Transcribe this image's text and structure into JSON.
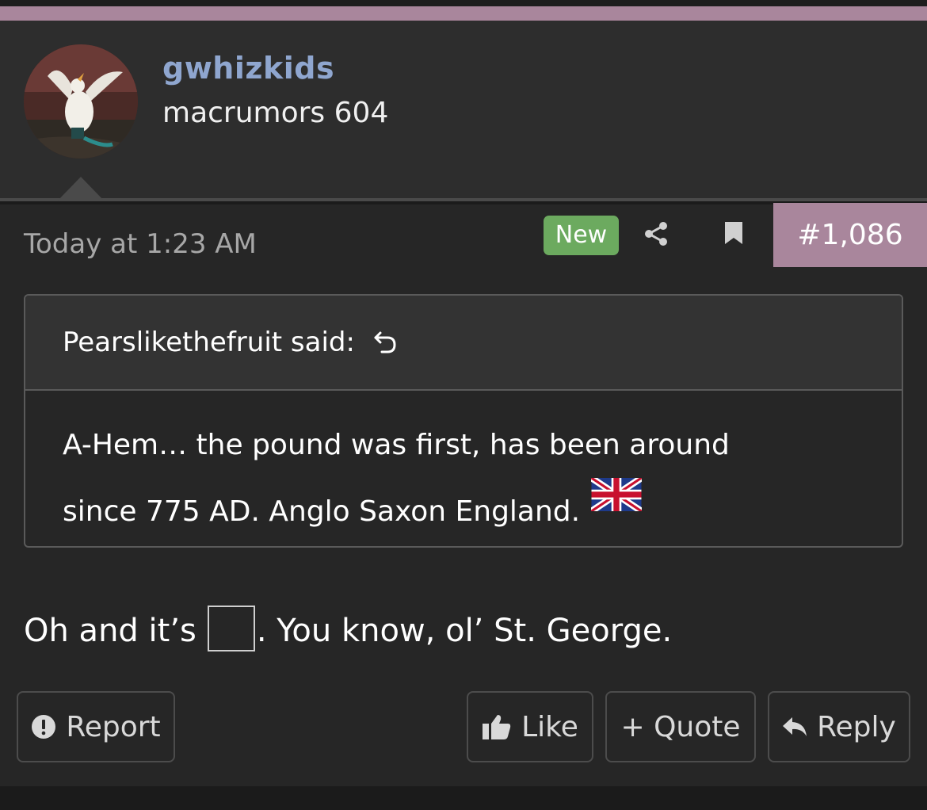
{
  "colors": {
    "accent": "#a9869c",
    "username": "#8fa6cf",
    "new_badge": "#6caa5f",
    "background": "#262626",
    "header_background": "#2d2d2d"
  },
  "user": {
    "username": "gwhizkids",
    "title": "macrumors 604",
    "avatar_icon": "duck-avatar"
  },
  "post": {
    "date": "Today at 1:23 AM",
    "new_badge": "New",
    "number": "#1,086",
    "share_icon": "share-icon",
    "bookmark_icon": "bookmark-icon"
  },
  "quote": {
    "author": "Pearslikethefruit said:",
    "jump_icon": "arrow-up-back-icon",
    "line1": "A-Hem… the pound was first, has been around",
    "line2": "since 775 AD. Anglo Saxon England.",
    "flag_icon": "uk-flag-icon"
  },
  "message": {
    "before": "Oh and it’s",
    "after": ". You know, ol’ St. George.",
    "missing_icon": "missing-glyph-box"
  },
  "actions": {
    "report": "Report",
    "like": "Like",
    "quote": "+ Quote",
    "reply": "Reply"
  }
}
